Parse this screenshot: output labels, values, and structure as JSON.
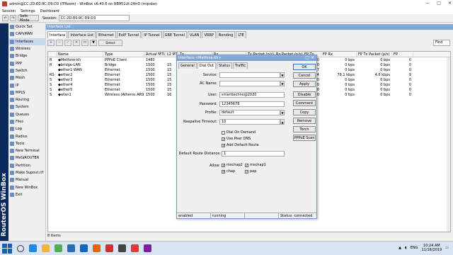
{
  "window": {
    "title": "admin@CC:2D:E0:9C:D9:D3 (ITRoom) - WinBox v6.40.6 on RB951Ui-2HnD (mipsbe)",
    "controls": [
      "—",
      "□",
      "✕"
    ]
  },
  "menu": [
    "Session",
    "Settings",
    "Dashboard"
  ],
  "toolbar": {
    "safe_mode": "Safe Mode",
    "session_label": "Session:",
    "session_value": "CC:2D:E0:9C:D9:D3"
  },
  "brand": "RouterOS WinBox",
  "sidebar": {
    "items": [
      {
        "label": "Quick Set"
      },
      {
        "label": "CAPsMAN"
      },
      {
        "label": "Interfaces"
      },
      {
        "label": "Wireless"
      },
      {
        "label": "Bridge"
      },
      {
        "label": "PPP"
      },
      {
        "label": "Switch"
      },
      {
        "label": "Mesh"
      },
      {
        "label": "IP"
      },
      {
        "label": "MPLS"
      },
      {
        "label": "Routing"
      },
      {
        "label": "System"
      },
      {
        "label": "Queues"
      },
      {
        "label": "Files"
      },
      {
        "label": "Log"
      },
      {
        "label": "Radius"
      },
      {
        "label": "Tools"
      },
      {
        "label": "New Terminal"
      },
      {
        "label": "MetaROUTER"
      },
      {
        "label": "Partition"
      },
      {
        "label": "Make Supout.rif"
      },
      {
        "label": "Manual"
      },
      {
        "label": "New WinBox"
      },
      {
        "label": "Exit"
      }
    ],
    "active_index": 2
  },
  "interface_list": {
    "title": "Interface List",
    "tabs": [
      "Interface",
      "Interface List",
      "Ethernet",
      "EoIP Tunnel",
      "IP Tunnel",
      "GRE Tunnel",
      "VLAN",
      "VRRP",
      "Bonding",
      "LTE"
    ],
    "find_label": "Find",
    "columns": [
      "",
      "Name",
      "Type",
      "Actual MTU",
      "L2 MTU",
      "Tx",
      "Rx",
      "Tx Packet (p/s)",
      "Rx Packet (p/s)",
      "FP Tx",
      "FP Rx",
      "FP Tx Packet (p/s)",
      "FP"
    ],
    "rows": [
      [
        "R",
        "◆Metfone-kh",
        "PPPoE Client",
        "1480",
        "",
        "",
        "",
        "",
        "",
        "0",
        "0 bps",
        "0 bps",
        "0"
      ],
      [
        "R",
        "◆bridge-LAN",
        "Bridge",
        "1500",
        "15",
        "",
        "",
        "",
        "",
        "0",
        "0 bps",
        "0 bps",
        "0"
      ],
      [
        "",
        "◆ether1-WAN",
        "Ethernet",
        "1500",
        "15",
        "",
        "",
        "",
        "",
        "7",
        "0 bps",
        "0 bps",
        "0"
      ],
      [
        "RS",
        "◆ether2",
        "Ethernet",
        "1500",
        "15",
        "",
        "",
        "",
        "",
        "14",
        "78.1 kbps",
        "4.6 kbps",
        "9"
      ],
      [
        "S",
        "◆ether3",
        "Ethernet",
        "1500",
        "15",
        "",
        "",
        "",
        "",
        "0",
        "0 bps",
        "0 bps",
        "0"
      ],
      [
        "S",
        "◆ether4",
        "Ethernet",
        "1500",
        "15",
        "",
        "",
        "",
        "",
        "0",
        "0 bps",
        "0 bps",
        "0"
      ],
      [
        "S",
        "◆ether5",
        "Ethernet",
        "1500",
        "15",
        "",
        "",
        "",
        "",
        "0",
        "0 bps",
        "0 bps",
        "0"
      ],
      [
        "S",
        "◆wlan1",
        "Wireless (Atheros AR9...",
        "1500",
        "16",
        "",
        "",
        "",
        "",
        "0",
        "0 bps",
        "0 bps",
        "0"
      ]
    ],
    "footer": "8 items"
  },
  "dialog": {
    "title": "Interface <Metfone-kh>",
    "tabs": [
      "General",
      "Dial Out",
      "Status",
      "Traffic"
    ],
    "selected_tab": 1,
    "fields": {
      "service": {
        "label": "Service:",
        "value": ""
      },
      "ac_name": {
        "label": "AC Name:",
        "value": ""
      },
      "user": {
        "label": "User:",
        "value": "smarttechno@2020"
      },
      "password": {
        "label": "Password:",
        "value": "12345678"
      },
      "profile": {
        "label": "Profile:",
        "value": "default"
      },
      "keepalive": {
        "label": "Keepalive Timeout:",
        "value": "10"
      },
      "default_route_distance": {
        "label": "Default Route Distance:",
        "value": "1"
      }
    },
    "checks": {
      "dial_on_demand": {
        "label": "Dial On Demand",
        "checked": false
      },
      "use_peer_dns": {
        "label": "Use Peer DNS",
        "checked": true
      },
      "add_default_route": {
        "label": "Add Default Route",
        "checked": true
      }
    },
    "allow": {
      "label": "Allow:",
      "mschap2": {
        "label": "mschap2",
        "checked": true
      },
      "mschap1": {
        "label": "mschap1",
        "checked": true
      },
      "chap": {
        "label": "chap",
        "checked": true
      },
      "pap": {
        "label": "pap",
        "checked": true
      }
    },
    "buttons": [
      "OK",
      "Cancel",
      "Apply",
      "Disable",
      "Comment",
      "Copy",
      "Remove",
      "Torch",
      "PPPoE Scan"
    ],
    "status": {
      "enabled": "enabled",
      "running": "running",
      "slave": "",
      "connection": "Status: connected"
    }
  },
  "taskbar": {
    "lang": "ENG",
    "time": "10:24 AM",
    "date": "11/16/2019",
    "icons": [
      {
        "name": "edge-icon",
        "color": "#1e88e5"
      },
      {
        "name": "folder-icon",
        "color": "#f2b632"
      },
      {
        "name": "chrome-icon",
        "color": "#4caf50"
      },
      {
        "name": "store-icon",
        "color": "#2b6cb0"
      },
      {
        "name": "vscode-icon",
        "color": "#1565c0"
      },
      {
        "name": "firefox-icon",
        "color": "#e8640c"
      },
      {
        "name": "pdf-icon",
        "color": "#d32f2f"
      },
      {
        "name": "winbox-icon",
        "color": "#444"
      },
      {
        "name": "camera-icon",
        "color": "#e53935"
      },
      {
        "name": "ide-icon",
        "color": "#7b1fa2"
      }
    ]
  }
}
